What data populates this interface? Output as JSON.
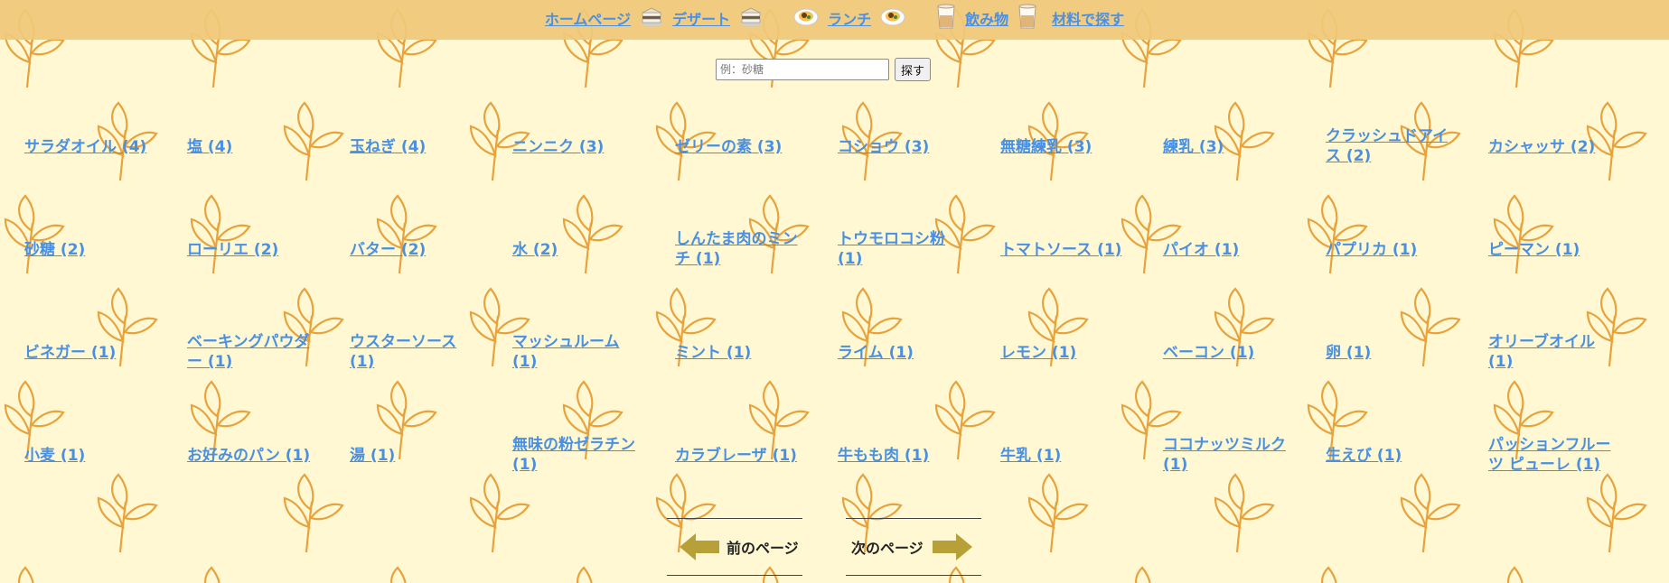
{
  "nav": {
    "items": [
      {
        "label": "ホームページ",
        "icon": ""
      },
      {
        "label": "デザート",
        "icon": "cake-icon"
      },
      {
        "label": "ランチ",
        "icon": "lunch-plate-icon"
      },
      {
        "label": "飲み物",
        "icon": "drink-cup-icon"
      },
      {
        "label": "材料で探す",
        "icon": ""
      }
    ]
  },
  "search": {
    "placeholder": "例：砂糖",
    "button_label": "探す"
  },
  "ingredients": [
    [
      "サラダオイル (4)",
      "塩 (4)",
      "玉ねぎ (4)",
      "ニンニク (3)",
      "ゼリーの素 (3)",
      "コショウ (3)",
      "無糖練乳 (3)",
      "練乳 (3)",
      "クラッシュドアイス (2)",
      "カシャッサ (2)"
    ],
    [
      "砂糖 (2)",
      "ローリエ (2)",
      "バター (2)",
      "水 (2)",
      "しんたま肉のミンチ (1)",
      "トウモロコシ粉 (1)",
      "トマトソース (1)",
      "パイオ (1)",
      "パプリカ (1)",
      "ピーマン (1)"
    ],
    [
      "ビネガー (1)",
      "ベーキングパウダー (1)",
      "ウスターソース (1)",
      "マッシュルーム (1)",
      "ミント (1)",
      "ライム (1)",
      "レモン (1)",
      "ベーコン (1)",
      "卵 (1)",
      "オリーブオイル (1)"
    ],
    [
      "小麦 (1)",
      "お好みのパン (1)",
      "湯 (1)",
      "無味の粉ゼラチン (1)",
      "カラブレーザ (1)",
      "牛もも肉 (1)",
      "牛乳 (1)",
      "ココナッツミルク (1)",
      "生えび (1)",
      "パッションフルーツ ピューレ (1)"
    ]
  ],
  "pager": {
    "prev_label": "前のページ",
    "next_label": "次のページ"
  },
  "colors": {
    "background": "#fff8d2",
    "header": "#f0c87a",
    "link": "#4a90e2",
    "leaf": "#e8a23c",
    "arrow": "#b8a038"
  }
}
